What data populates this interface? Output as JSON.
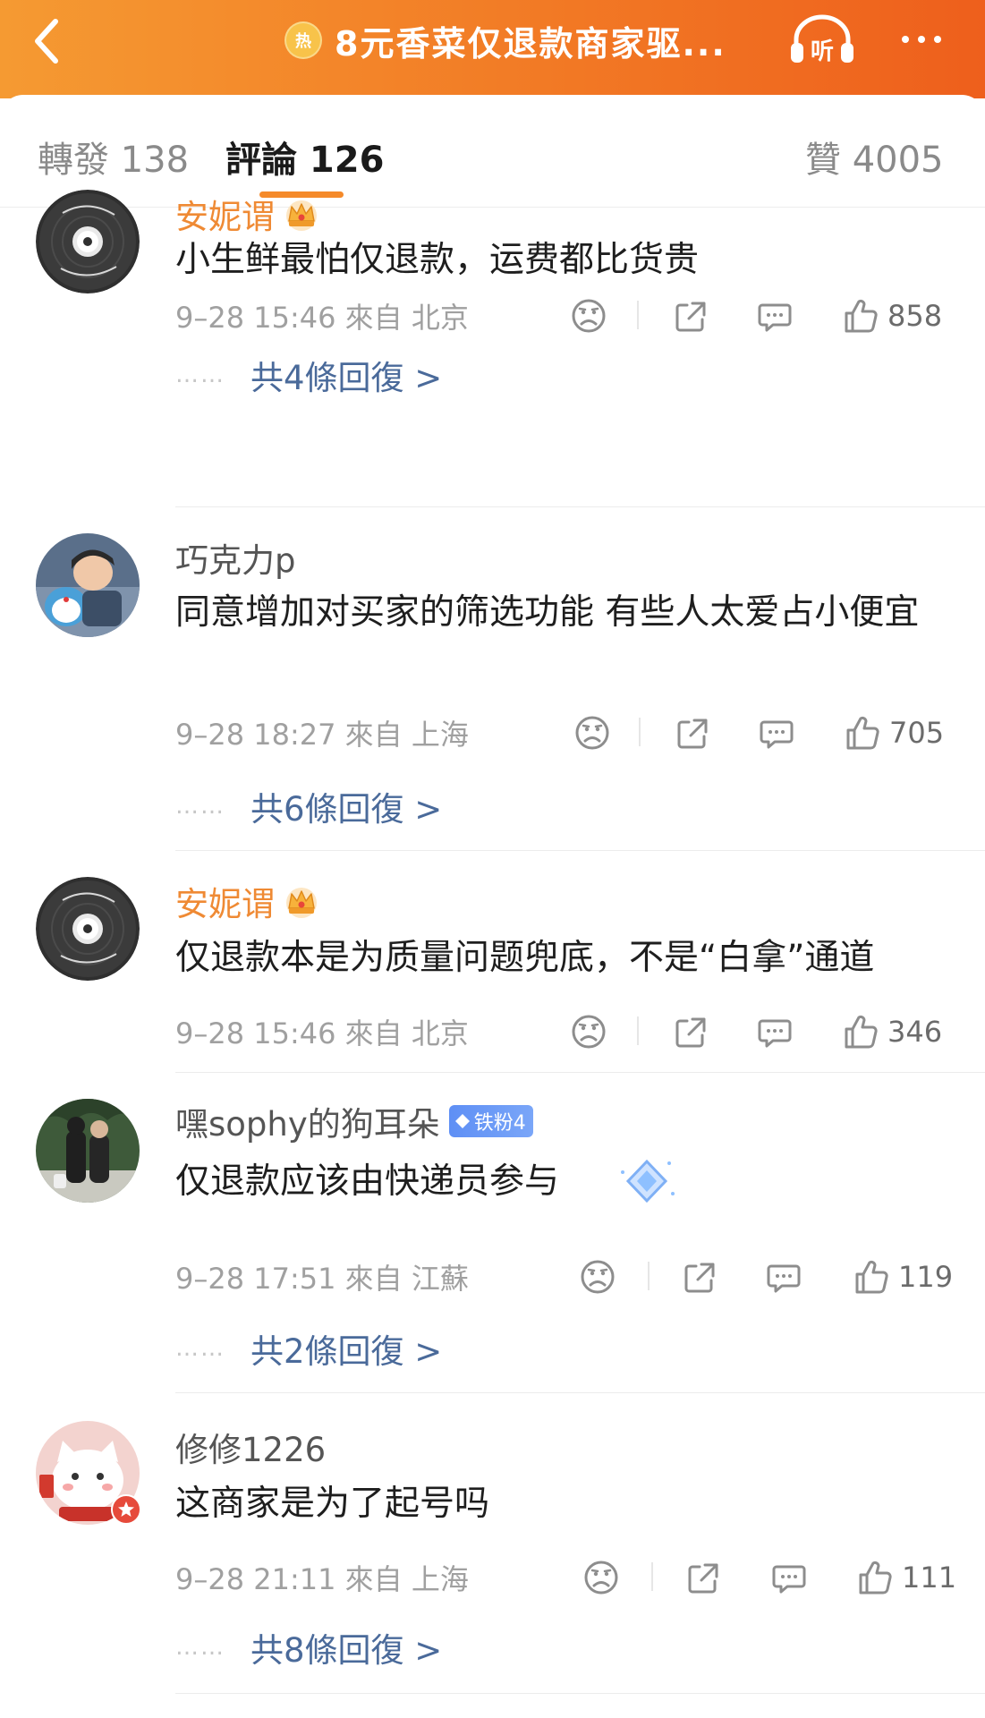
{
  "header": {
    "title": "8元香菜仅退款商家驱...",
    "hot_badge": "热",
    "listen_label": "听",
    "accent_color": "#f27a25"
  },
  "tabs": [
    {
      "label": "轉發 138"
    },
    {
      "label": "評論 126",
      "active": true
    },
    {
      "label": "贊 4005"
    }
  ],
  "comments": [
    {
      "user": "安妮谓",
      "vip": true,
      "text": "小生鲜最怕仅退款，运费都比货贵",
      "meta": "9–28 15:46 來自 北京",
      "likes": "858",
      "replies": "共4條回復 >"
    },
    {
      "user": "巧克力p",
      "vip": false,
      "text": "同意增加对买家的筛选功能 有些人太爱占小便宜",
      "meta": "9–28 18:27 來自 上海",
      "likes": "705",
      "replies": "共6條回復 >"
    },
    {
      "user": "安妮谓",
      "vip": true,
      "text": "仅退款本是为质量问题兜底，不是“白拿”通道",
      "meta": "9–28 15:46 來自 北京",
      "likes": "346"
    },
    {
      "user": "嘿sophy的狗耳朵",
      "badge": "铁粉4",
      "vip": false,
      "text": "仅退款应该由快递员参与",
      "meta": "9–28 17:51 來自 江蘇",
      "likes": "119",
      "replies": "共2條回復 >"
    },
    {
      "user": "修修1226",
      "vip": false,
      "text": "这商家是为了起号吗",
      "meta": "9–28 21:11 來自 上海",
      "likes": "111",
      "replies": "共8條回復 >"
    }
  ],
  "ui": {
    "reply_dots": "……"
  }
}
